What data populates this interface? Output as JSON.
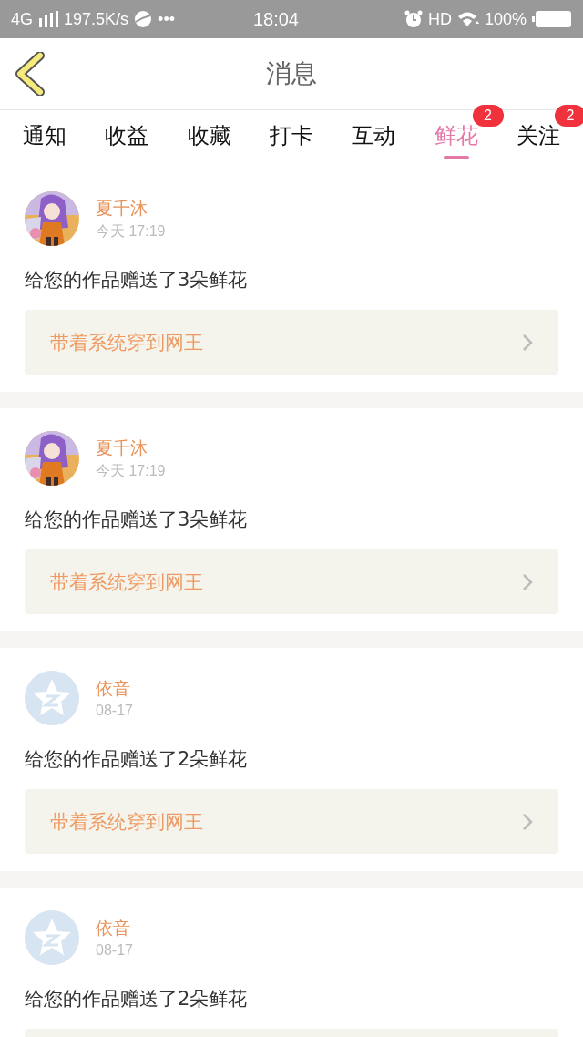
{
  "status_bar": {
    "network": "4G",
    "speed": "197.5K/s",
    "more": "•••",
    "time": "18:04",
    "hd": "HD",
    "battery": "100%"
  },
  "header": {
    "title": "消息"
  },
  "tabs": [
    {
      "label": "通知",
      "selected": false
    },
    {
      "label": "收益",
      "selected": false
    },
    {
      "label": "收藏",
      "selected": false
    },
    {
      "label": "打卡",
      "selected": false
    },
    {
      "label": "互动",
      "selected": false
    },
    {
      "label": "鲜花",
      "selected": true,
      "badge": "2"
    },
    {
      "label": "关注",
      "selected": false,
      "badge": "2"
    }
  ],
  "messages": [
    {
      "kind": "picture",
      "name": "夏千沐",
      "time": "今天 17:19",
      "text": "给您的作品赠送了3朵鲜花",
      "link": "带着系统穿到网王"
    },
    {
      "kind": "picture",
      "name": "夏千沐",
      "time": "今天 17:19",
      "text": "给您的作品赠送了3朵鲜花",
      "link": "带着系统穿到网王"
    },
    {
      "kind": "default",
      "name": "依音",
      "time": "08-17",
      "text": "给您的作品赠送了2朵鲜花",
      "link": "带着系统穿到网王"
    },
    {
      "kind": "default",
      "name": "依音",
      "time": "08-17",
      "text": "给您的作品赠送了2朵鲜花"
    }
  ]
}
